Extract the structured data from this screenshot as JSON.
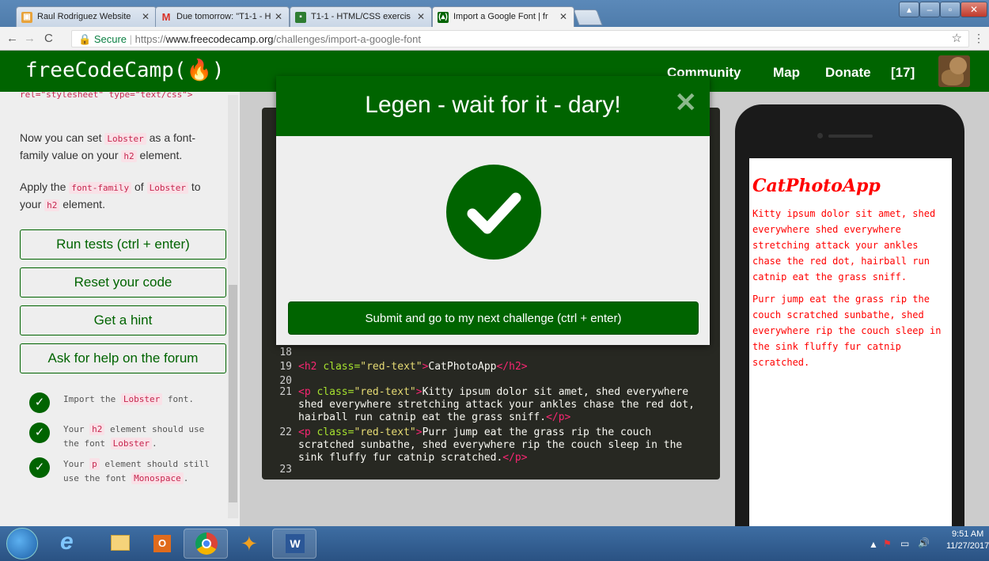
{
  "browser": {
    "tabs": [
      {
        "title": "Raul Rodriguez Website",
        "icon": "codepen-icon"
      },
      {
        "title": "Due tomorrow: \"T1-1 - H",
        "icon": "gmail-icon"
      },
      {
        "title": "T1-1 - HTML/CSS exercis",
        "icon": "classroom-icon"
      },
      {
        "title": "Import a Google Font | fr",
        "icon": "fcc-icon"
      }
    ],
    "secure_label": "Secure",
    "url_prefix": "https://",
    "url_host": "www.freecodecamp.org",
    "url_path": "/challenges/import-a-google-font"
  },
  "fcc": {
    "logo": "freeCodeCamp(🔥)",
    "nav": [
      "Community",
      "Map",
      "Donate"
    ],
    "points": "[17]"
  },
  "left": {
    "clipped_text": "rel=\"stylesheet\" type=\"text/css\">",
    "p1_a": "Now you can set ",
    "p1_code": "Lobster",
    "p1_b": " as a font-family value on your ",
    "p1_code2": "h2",
    "p1_c": " element.",
    "p2_a": "Apply the ",
    "p2_code": "font-family",
    "p2_b": " of ",
    "p2_code2": "Lobster",
    "p2_c": " to your ",
    "p2_code3": "h2",
    "p2_d": " element.",
    "buttons": [
      "Run tests (ctrl + enter)",
      "Reset your code",
      "Get a hint",
      "Ask for help on the forum"
    ],
    "tests": [
      {
        "a": "Import the ",
        "code": "Lobster",
        "b": " font."
      },
      {
        "a": "Your ",
        "code": "h2",
        "b": " element should use the font ",
        "code2": "Lobster",
        "c": "."
      },
      {
        "a": "Your ",
        "code": "p",
        "b": " element should still use the font ",
        "code2": "Monospace",
        "c": "."
      }
    ]
  },
  "editor": {
    "line_numbers": [
      "18",
      "19",
      "20",
      "21",
      "22",
      "23"
    ],
    "l19_open": "<h2 ",
    "l19_attr": "class=",
    "l19_str": "\"red-text\"",
    "l19_gt": ">",
    "l19_text": "CatPhotoApp",
    "l19_close": "</h2>",
    "l21_open": "<p ",
    "l21_attr": "class=",
    "l21_str": "\"red-text\"",
    "l21_gt": ">",
    "l21_text1": "Kitty ipsum dolor sit amet, shed everywhere",
    "l21_text2": "shed everywhere stretching attack your ankles chase the red dot,",
    "l21_text3": "hairball run catnip eat the grass sniff.",
    "l21_close": "</p>",
    "l22_open": "<p ",
    "l22_attr": "class=",
    "l22_str": "\"red-text\"",
    "l22_gt": ">",
    "l22_text1": "Purr jump eat the grass rip the couch",
    "l22_text2": "scratched sunbathe, shed everywhere rip the couch sleep in the",
    "l22_text3": "sink fluffy fur catnip scratched.",
    "l22_close": "</p>"
  },
  "preview": {
    "title": "CatPhotoApp",
    "p1": "Kitty ipsum dolor sit amet, shed everywhere shed everywhere stretching attack your ankles chase the red dot, hairball run catnip eat the grass sniff.",
    "p2": "Purr jump eat the grass rip the couch scratched sunbathe, shed everywhere rip the couch sleep in the sink fluffy fur catnip scratched."
  },
  "modal": {
    "title": "Legen - wait for it - dary!",
    "submit_label": "Submit and go to my next challenge (ctrl + enter)"
  },
  "taskbar": {
    "apps": [
      "ie-icon",
      "explorer-icon",
      "outlook-icon",
      "chrome-icon",
      "fox-app-icon",
      "word-icon"
    ],
    "time": "9:51 AM",
    "date": "11/27/2017"
  },
  "colors": {
    "fcc_green": "#006400",
    "editor_bg": "#272822",
    "preview_red": "#ff0000"
  }
}
